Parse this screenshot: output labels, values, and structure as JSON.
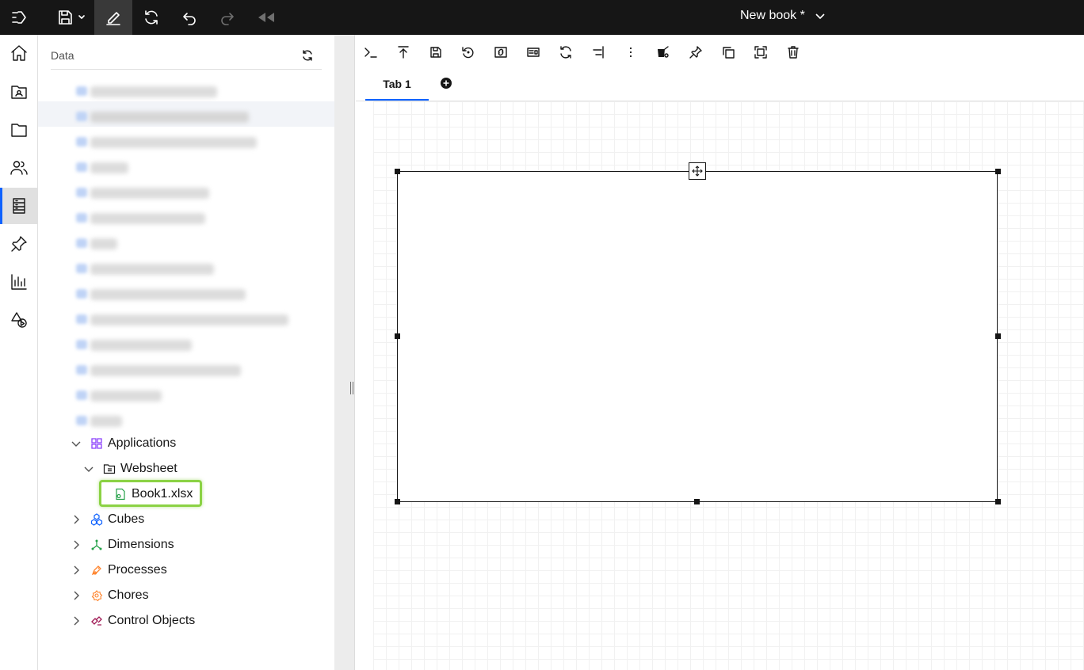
{
  "topbar": {
    "book_title": "New book *",
    "icons": [
      "collapse-menu-icon",
      "save-icon",
      "chevron-down-icon",
      "edit-icon",
      "refresh-icon",
      "undo-icon",
      "redo-icon",
      "rewind-icon"
    ]
  },
  "rail": {
    "items": [
      "home-icon",
      "user-folder-icon",
      "folder-icon",
      "users-icon",
      "data-icon",
      "pin-icon",
      "chart-icon",
      "shapes-icon"
    ],
    "active_index": 4
  },
  "panel": {
    "title": "Data",
    "tree": {
      "applications": "Applications",
      "websheet": "Websheet",
      "book": "Book1.xlsx",
      "cubes": "Cubes",
      "dimensions": "Dimensions",
      "processes": "Processes",
      "chores": "Chores",
      "control_objects": "Control Objects"
    }
  },
  "toolbar": {
    "icons": [
      "terminal-icon",
      "upload-icon",
      "save-icon",
      "reset-icon",
      "link-icon",
      "card-icon",
      "refresh-icon",
      "align-icon",
      "overflow-icon",
      "paint-icon",
      "pin-icon",
      "copy-icon",
      "fit-icon",
      "delete-icon"
    ]
  },
  "tabs": {
    "items": [
      "Tab 1"
    ],
    "add_icon": "add-tab-icon"
  },
  "colors": {
    "topbar_bg": "#161616",
    "accent": "#0f62fe",
    "highlight": "#8bd244"
  }
}
